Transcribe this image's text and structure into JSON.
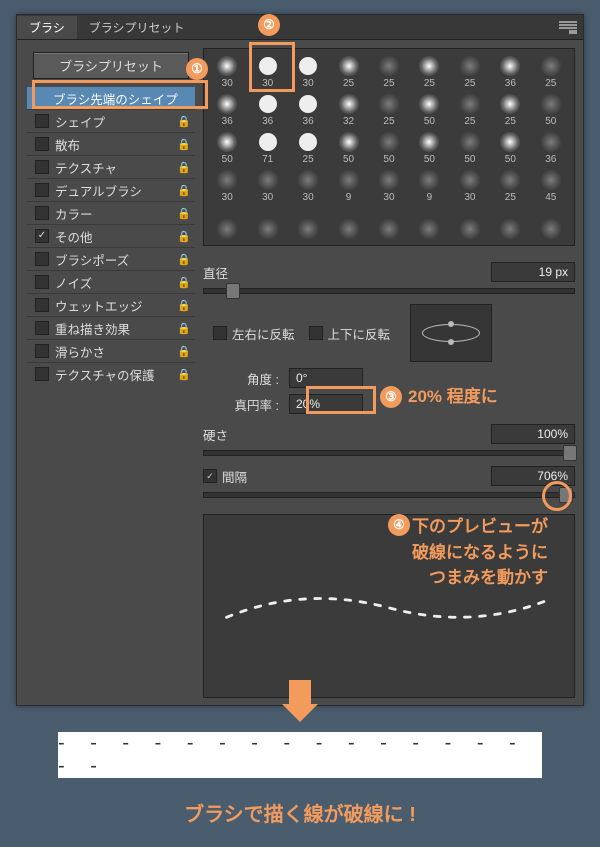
{
  "tabs": {
    "brush": "ブラシ",
    "preset": "ブラシプリセット"
  },
  "presetBtn": "ブラシプリセット",
  "options": [
    {
      "label": "ブラシ先端のシェイプ",
      "sel": true,
      "check": null,
      "lock": false
    },
    {
      "label": "シェイプ",
      "check": false,
      "lock": true
    },
    {
      "label": "散布",
      "check": false,
      "lock": true
    },
    {
      "label": "テクスチャ",
      "check": false,
      "lock": true
    },
    {
      "label": "デュアルブラシ",
      "check": false,
      "lock": true
    },
    {
      "label": "カラー",
      "check": false,
      "lock": true
    },
    {
      "label": "その他",
      "check": true,
      "lock": true
    },
    {
      "label": "ブラシポーズ",
      "check": false,
      "lock": true
    },
    {
      "label": "ノイズ",
      "check": false,
      "lock": true
    },
    {
      "label": "ウェットエッジ",
      "check": false,
      "lock": true
    },
    {
      "label": "重ね描き効果",
      "check": false,
      "lock": true
    },
    {
      "label": "滑らかさ",
      "check": false,
      "lock": true
    },
    {
      "label": "テクスチャの保護",
      "check": false,
      "lock": true
    }
  ],
  "brushSizes": [
    [
      "30",
      "30",
      "30",
      "25",
      "25",
      "25",
      "25",
      "36",
      "25"
    ],
    [
      "36",
      "36",
      "36",
      "32",
      "25",
      "50",
      "25",
      "25",
      "50"
    ],
    [
      "50",
      "71",
      "25",
      "50",
      "50",
      "50",
      "50",
      "50",
      "36"
    ],
    [
      "30",
      "30",
      "30",
      "9",
      "30",
      "9",
      "30",
      "25",
      "45"
    ],
    [
      "",
      "",
      "",
      "",
      "",
      "",
      "",
      "",
      ""
    ]
  ],
  "labels": {
    "diameter": "直径",
    "flipX": "左右に反転",
    "flipY": "上下に反転",
    "angle": "角度 :",
    "roundness": "真円率 :",
    "hardness": "硬さ",
    "spacing": "間隔"
  },
  "values": {
    "diameter": "19 px",
    "angle": "0°",
    "roundness": "20%",
    "hardness": "100%",
    "spacing": "706%"
  },
  "annot": {
    "n3": "20% 程度に",
    "n4a": "下のプレビューが",
    "n4b": "破線になるように",
    "n4c": "つまみを動かす"
  },
  "badges": {
    "b1": "①",
    "b2": "②",
    "b3": "③",
    "b4": "④"
  },
  "result": "- - - - - - - - - - - - - - - - -",
  "caption": "ブラシで描く線が破線に !"
}
